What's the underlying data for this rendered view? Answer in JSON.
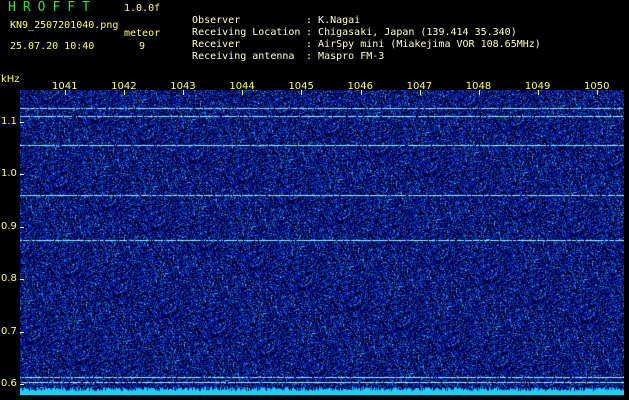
{
  "header": {
    "app_title": "HROFFT",
    "version": "1.0.0f",
    "file_name": "KN9_2507201040.png",
    "timestamp": "25.07.20 10:40",
    "meteor_label": "meteor",
    "meteor_count": "9"
  },
  "info": [
    {
      "key": "Observer",
      "value": "K.Nagai"
    },
    {
      "key": "Receiving Location",
      "value": "Chigasaki, Japan (139.414 35.340)"
    },
    {
      "key": "Receiver",
      "value": "AirSpy mini (Miakejima VOR 108.65MHz)"
    },
    {
      "key": "Receiving antenna",
      "value": "Maspro FM-3"
    }
  ],
  "spectrogram": {
    "unit": "kHz",
    "time_ticks": [
      "1041",
      "1042",
      "1043",
      "1044",
      "1045",
      "1046",
      "1047",
      "1048",
      "1049",
      "1050"
    ],
    "freq_ticks": [
      "1.1",
      "1.0",
      "0.9",
      "0.8",
      "0.7",
      "0.6"
    ],
    "freq_range_khz": [
      0.58,
      1.16
    ],
    "signal_lines_khz": [
      1.125,
      1.11,
      1.055,
      0.96,
      0.875,
      0.615,
      0.605
    ],
    "colors": {
      "background": "#000044",
      "noise": "#1c3ea8",
      "signal": "#99eeff",
      "axis_text": "#ffff66",
      "title": "#33dd33"
    }
  }
}
